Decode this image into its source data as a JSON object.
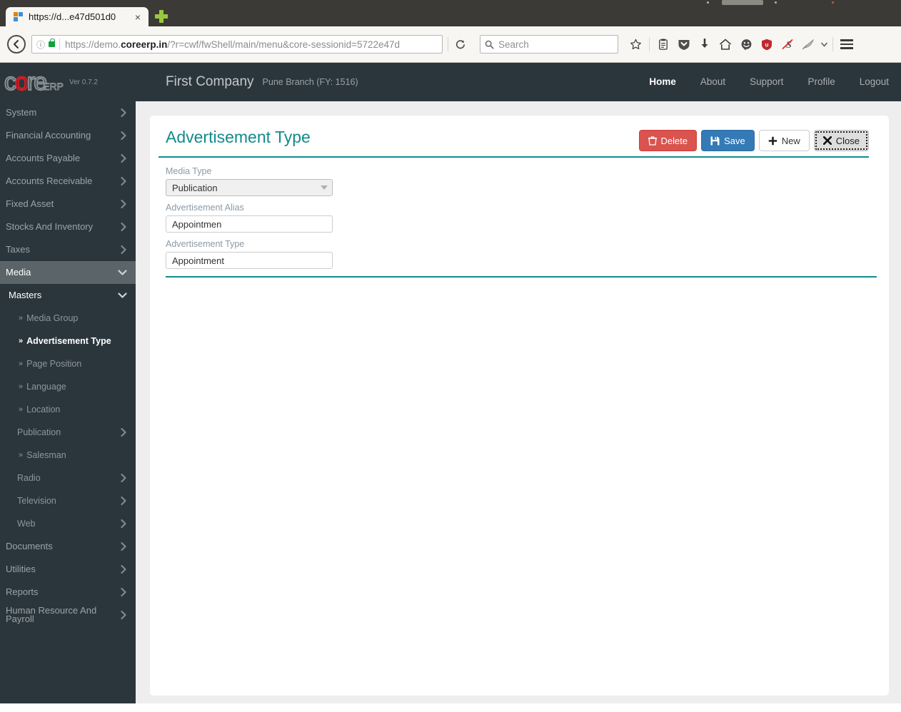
{
  "browser": {
    "tab": {
      "title": "https://d...e47d501d0",
      "close_label": "×",
      "favicon": "tab-favicon-icon"
    },
    "newtab_label": "+",
    "back_label": "←",
    "info_label": "ⓘ",
    "url_prefix": "https://demo.",
    "url_domain": "coreerp.in",
    "url_suffix": "/?r=cwf/fwShell/main/menu&core-sessionid=5722e47d",
    "reload_label": "⟳",
    "search_placeholder": "Search",
    "icons": [
      "bookmark-star-icon",
      "reading-list-icon",
      "pocket-shield-icon",
      "downloads-arrow-icon",
      "home-icon",
      "smiley-face-icon",
      "ublock-origin-icon",
      "no-script-icon",
      "feather-extension-icon",
      "chevron-down-icon",
      "hamburger-menu-icon"
    ]
  },
  "app_header": {
    "logo": {
      "letters": [
        "c",
        "o",
        "r",
        "e"
      ],
      "red_letter_index": 1,
      "suffix": "ERP",
      "version": "Ver 0.7.2"
    },
    "company": "First Company",
    "branch": "Pune Branch (FY: 1516)",
    "nav": [
      {
        "label": "Home",
        "active": true
      },
      {
        "label": "About",
        "active": false
      },
      {
        "label": "Support",
        "active": false
      },
      {
        "label": "Profile",
        "active": false
      },
      {
        "label": "Logout",
        "active": false
      }
    ]
  },
  "sidebar": {
    "items": [
      {
        "label": "System",
        "type": "collapsed"
      },
      {
        "label": "Financial Accounting",
        "type": "collapsed"
      },
      {
        "label": "Accounts Payable",
        "type": "collapsed"
      },
      {
        "label": "Accounts Receivable",
        "type": "collapsed"
      },
      {
        "label": "Fixed Asset",
        "type": "collapsed"
      },
      {
        "label": "Stocks And Inventory",
        "type": "collapsed"
      },
      {
        "label": "Taxes",
        "type": "collapsed"
      },
      {
        "label": "Media",
        "type": "expanded-active"
      },
      {
        "label": "Masters",
        "type": "expanded-sub"
      },
      {
        "label": "Media Group",
        "type": "leaf"
      },
      {
        "label": "Advertisement Type",
        "type": "leaf-active"
      },
      {
        "label": "Page Position",
        "type": "leaf"
      },
      {
        "label": "Language",
        "type": "leaf"
      },
      {
        "label": "Location",
        "type": "leaf"
      },
      {
        "label": "Publication",
        "type": "sub-collapsed"
      },
      {
        "label": "Salesman",
        "type": "leaf"
      },
      {
        "label": "Radio",
        "type": "sub-collapsed"
      },
      {
        "label": "Television",
        "type": "sub-collapsed"
      },
      {
        "label": "Web",
        "type": "sub-collapsed"
      },
      {
        "label": "Documents",
        "type": "collapsed"
      },
      {
        "label": "Utilities",
        "type": "collapsed"
      },
      {
        "label": "Reports",
        "type": "collapsed"
      },
      {
        "label": "Human Resource And Payroll",
        "type": "collapsed-2line"
      }
    ],
    "bullet": "»"
  },
  "page": {
    "title": "Advertisement Type",
    "buttons": [
      {
        "label": "Delete",
        "icon": "trash-icon",
        "style": "delete"
      },
      {
        "label": "Save",
        "icon": "floppy-disk-icon",
        "style": "save"
      },
      {
        "label": "New",
        "icon": "plus-icon",
        "style": "new"
      },
      {
        "label": "Close",
        "icon": "x-icon",
        "style": "close"
      }
    ],
    "fields": [
      {
        "label": "Media Type",
        "value": "Publication",
        "kind": "select"
      },
      {
        "label": "Advertisement Alias",
        "value": "Appointmen",
        "kind": "text"
      },
      {
        "label": "Advertisement Type",
        "value": "Appointment",
        "kind": "text"
      }
    ]
  },
  "colors": {
    "accent_teal": "#138a8a",
    "sidebar_bg": "#2b363c",
    "header_bg": "#2b363c",
    "active_sidebar": "#5b6569",
    "btn_delete": "#d9534f",
    "btn_save": "#337ab7",
    "logo_red": "#e01b24",
    "page_bg": "#eeeeee"
  }
}
